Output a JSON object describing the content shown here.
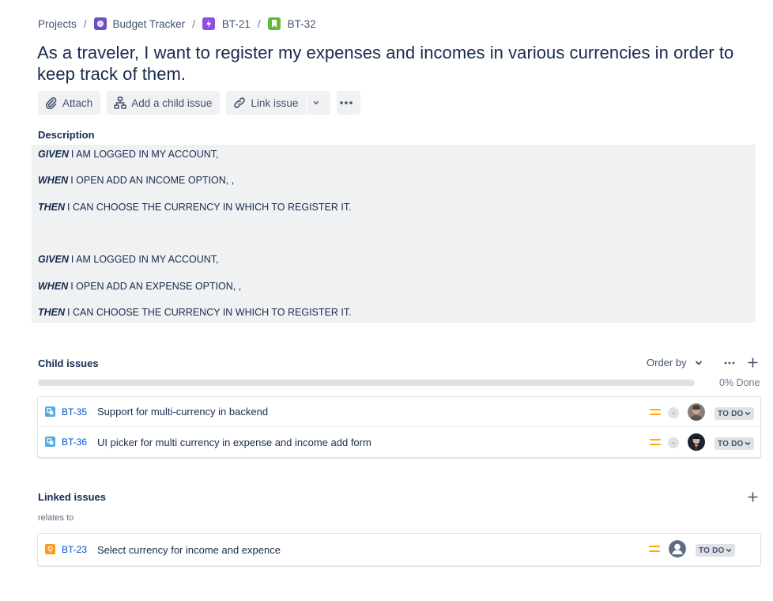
{
  "breadcrumb": {
    "projects": "Projects",
    "project": "Budget Tracker",
    "epic": "BT-21",
    "story": "BT-32",
    "separator": "/"
  },
  "title": "As a traveler, I want to register my expenses and incomes in various currencies in order to keep track of them.",
  "toolbar": {
    "attach": "Attach",
    "add_child": "Add a child issue",
    "link_issue": "Link issue"
  },
  "description": {
    "label": "Description",
    "lines": [
      {
        "keyword": "GIVEN",
        "text": "I AM LOGGED IN MY ACCOUNT,"
      },
      {
        "keyword": "WHEN",
        "text": "I OPEN ADD AN INCOME OPTION, ,"
      },
      {
        "keyword": "THEN",
        "text": "I CAN CHOOSE THE CURRENCY IN WHICH TO REGISTER IT."
      },
      {
        "keyword": "GIVEN",
        "text": "I AM LOGGED IN MY ACCOUNT,"
      },
      {
        "keyword": "WHEN",
        "text": "I OPEN ADD AN EXPENSE OPTION, ,"
      },
      {
        "keyword": "THEN",
        "text": "I CAN CHOOSE THE CURRENCY IN WHICH TO REGISTER IT."
      }
    ]
  },
  "child_issues": {
    "label": "Child issues",
    "order_by": "Order by",
    "progress": 0,
    "progress_label": "0% Done",
    "items": [
      {
        "key": "BT-35",
        "summary": "Support for multi-currency in backend",
        "estimate": "-",
        "status": "TO DO"
      },
      {
        "key": "BT-36",
        "summary": "UI picker for multi currency in expense and income add form",
        "estimate": "-",
        "status": "TO DO"
      }
    ]
  },
  "linked_issues": {
    "label": "Linked issues",
    "relation": "relates to",
    "items": [
      {
        "key": "BT-23",
        "summary": "Select currency for income and expence",
        "status": "TO DO"
      }
    ]
  },
  "colors": {
    "link": "#0052cc",
    "priority_medium": "#ffab00",
    "subtask": "#4bade8",
    "improvement": "#ff991f",
    "epic": "#904ee2",
    "story": "#63ba3c",
    "project": "#6554c0"
  }
}
